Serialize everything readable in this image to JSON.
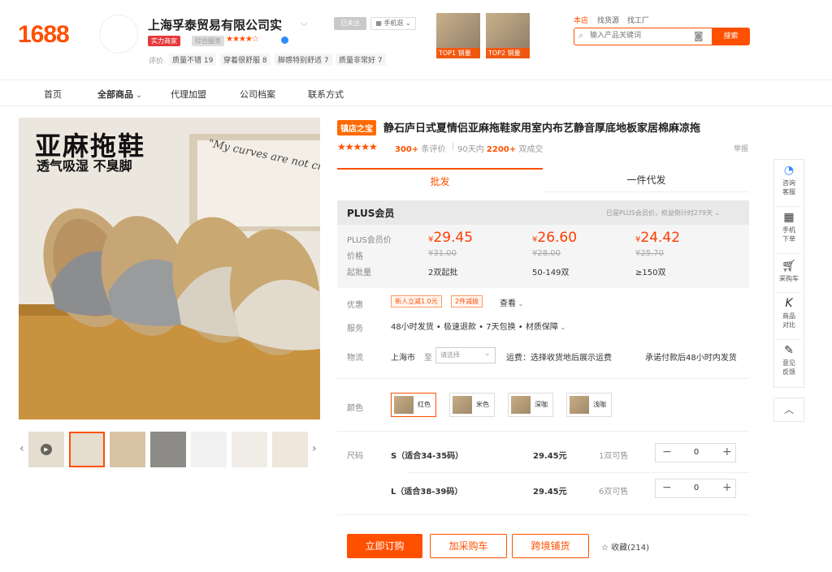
{
  "header": {
    "logo": "1688",
    "shop_name": "上海孚泰贸易有限公司实",
    "badge_strength": "实力商家",
    "badge_service": "综合服务",
    "service_stars": "★★★★☆",
    "eval_label": "评价",
    "eval_chips": [
      "质量不错 19",
      "穿着很舒服 8",
      "脚感特别舒适 7",
      "质量非常好 7"
    ],
    "follow": "已关注",
    "mobile": "手机逛",
    "top_products": [
      "TOP1 销量",
      "TOP2 销量"
    ],
    "scope_tabs": [
      "本店",
      "找货源",
      "找工厂"
    ],
    "search_placeholder": "输入产品关键词",
    "search_button": "搜索"
  },
  "nav": [
    "首页",
    "全部商品",
    "代理加盟",
    "公司档案",
    "联系方式"
  ],
  "gallery": {
    "headline": "亚麻拖鞋",
    "subline": "透气吸湿 不臭脚",
    "poster_text": "\"My curves are not cra"
  },
  "product": {
    "badge": "镇店之宝",
    "title": "静石庐日式夏情侣亚麻拖鞋家用室内布艺静音厚底地板家居棉麻凉拖",
    "stars": "★★★★★",
    "reviews_count": "300+",
    "reviews_label": "条评价",
    "period": "90天内",
    "sales_count": "2200+",
    "sales_label": "双成交",
    "report": "举报"
  },
  "tabs": [
    "批发",
    "一件代发"
  ],
  "plus": {
    "title": "PLUS会员",
    "note": "已是PLUS会员价，权益倒计时279天",
    "row_labels": [
      "PLUS会员价",
      "价格",
      "起批量"
    ],
    "tiers": [
      {
        "yen": "¥",
        "plus_price": "29.45",
        "price": "¥31.00",
        "moq": "2双起批"
      },
      {
        "yen": "¥",
        "plus_price": "26.60",
        "price": "¥28.00",
        "moq": "50-149双"
      },
      {
        "yen": "¥",
        "plus_price": "24.42",
        "price": "¥25.70",
        "moq": "≥150双"
      }
    ]
  },
  "offers": {
    "label": "优惠",
    "chips": [
      "新人立减1.0元",
      "2件减拨"
    ],
    "view": "查看"
  },
  "service": {
    "label": "服务",
    "text": "48小时发货 • 极速退款 • 7天包换 • 材质保障"
  },
  "logistics": {
    "label": "物流",
    "from": "上海市",
    "to": "至",
    "select_placeholder": "请选择",
    "fee": "运费：选择收货地后展示运费",
    "promise": "承诺付款后48小时内发货"
  },
  "colors": {
    "label": "颜色",
    "options": [
      "红色",
      "米色",
      "深咖",
      "浅咖"
    ]
  },
  "sizes": {
    "label": "尺码",
    "rows": [
      {
        "name": "S（适合34-35码）",
        "price": "29.45元",
        "stock": "1双可售",
        "qty": "0"
      },
      {
        "name": "L（适合38-39码）",
        "price": "29.45元",
        "stock": "6双可售",
        "qty": "0"
      }
    ]
  },
  "actions": {
    "buy": "立即订购",
    "cart": "加采购车",
    "cross": "跨境铺货",
    "fav": "收藏(214)"
  },
  "float_bar": [
    {
      "label1": "咨询",
      "label2": "客服"
    },
    {
      "label1": "手机",
      "label2": "下单"
    },
    {
      "label1": "采购车",
      "label2": ""
    },
    {
      "label1": "商品",
      "label2": "对比"
    },
    {
      "label1": "意见",
      "label2": "反馈"
    }
  ],
  "colors_theme": {
    "brand": "#ff5000",
    "price": "#ff3c00"
  }
}
